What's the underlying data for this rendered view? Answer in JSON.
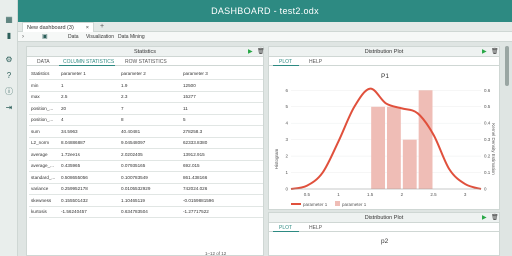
{
  "app": {
    "title": "DASHBOARD - test2.odx"
  },
  "tabs": [
    {
      "label": "New dashboard (3)",
      "close": "×"
    }
  ],
  "add_tab": "+",
  "menu": {
    "items": [
      "Data",
      "Visualization",
      "Data Mining"
    ]
  },
  "stats_panel": {
    "title": "Statistics",
    "tabs": [
      "DATA",
      "COLUMN STATISTICS",
      "ROW STATISTICS"
    ],
    "active_tab": 1,
    "columns": [
      "Statistics",
      "parameter 1",
      "parameter 2",
      "parameter 3"
    ],
    "rows": [
      [
        "min",
        "1",
        "1.9",
        "12500"
      ],
      [
        "max",
        "2.5",
        "2.3",
        "15277"
      ],
      [
        "position_...",
        "20",
        "7",
        "11"
      ],
      [
        "position_...",
        "4",
        "8",
        "5"
      ],
      [
        "sum",
        "34.5963",
        "40.40481",
        "278258.3"
      ],
      [
        "L2_norm",
        "8.04886887",
        "9.04548097",
        "62333.8380"
      ],
      [
        "average",
        "1.72ee1s",
        "2.0202405",
        "13912.915"
      ],
      [
        "average_...",
        "0.435965",
        "0.07935165",
        "692.015"
      ],
      [
        "standard_...",
        "0.508655056",
        "0.100783549",
        "861.438166"
      ],
      [
        "variance",
        "0.259952178",
        "0.0105532929",
        "742024.026"
      ],
      [
        "skewness",
        "0.155501432",
        "1.10465119",
        "-0.0159881596"
      ],
      [
        "kurtosis",
        "-1.56240457",
        "0.634783504",
        "-1.27717522"
      ]
    ],
    "pager": "1–12 of 12"
  },
  "dist_panel_1": {
    "title": "Distribution Plot",
    "tabs": [
      "PLOT",
      "HELP"
    ],
    "active_tab": 0,
    "plot_title": "P1",
    "ylabel_left": "Histogram",
    "ylabel_right": "Kernel Density Estimation",
    "legend": [
      "parameter 1",
      "parameter 1"
    ]
  },
  "dist_panel_2": {
    "title": "Distribution Plot",
    "tabs": [
      "PLOT",
      "HELP"
    ],
    "active_tab": 0,
    "plot_title": "p2"
  },
  "chart_data": {
    "type": "bar",
    "title": "P1",
    "ylabel": "Histogram",
    "y2label": "Kernel Density Estimation",
    "x_ticks": [
      "0.5",
      "1",
      "1.5",
      "2",
      "2.5",
      "3"
    ],
    "y_ticks": [
      "0",
      "1",
      "2",
      "3",
      "4",
      "5",
      "6"
    ],
    "y2_ticks": [
      "0",
      "0.1",
      "0.2",
      "0.3",
      "0.4",
      "0.5",
      "0.6"
    ],
    "xlim": [
      0.25,
      3.25
    ],
    "ylim": [
      0,
      6.2
    ],
    "y2lim": [
      0,
      0.62
    ],
    "bars": [
      {
        "x0": 1.5,
        "x1": 1.75,
        "value": 5
      },
      {
        "x0": 1.75,
        "x1": 2.0,
        "value": 5
      },
      {
        "x0": 2.0,
        "x1": 2.25,
        "value": 3
      },
      {
        "x0": 2.25,
        "x1": 2.5,
        "value": 6
      }
    ],
    "kde": {
      "x": [
        0.25,
        0.5,
        0.75,
        1.0,
        1.25,
        1.5,
        1.75,
        2.0,
        2.25,
        2.5,
        2.75,
        3.0,
        3.25
      ],
      "y": [
        0.0,
        0.02,
        0.1,
        0.29,
        0.5,
        0.61,
        0.52,
        0.49,
        0.46,
        0.33,
        0.12,
        0.03,
        0.0
      ]
    },
    "series": [
      {
        "name": "parameter 1",
        "kind": "kde",
        "color": "#e0503c"
      },
      {
        "name": "parameter 1",
        "kind": "histogram",
        "color": "#efbdb6"
      }
    ],
    "colors": {
      "kde": "#e0503c",
      "bars": "#efbdb6",
      "accent": "#2d8a82"
    }
  }
}
